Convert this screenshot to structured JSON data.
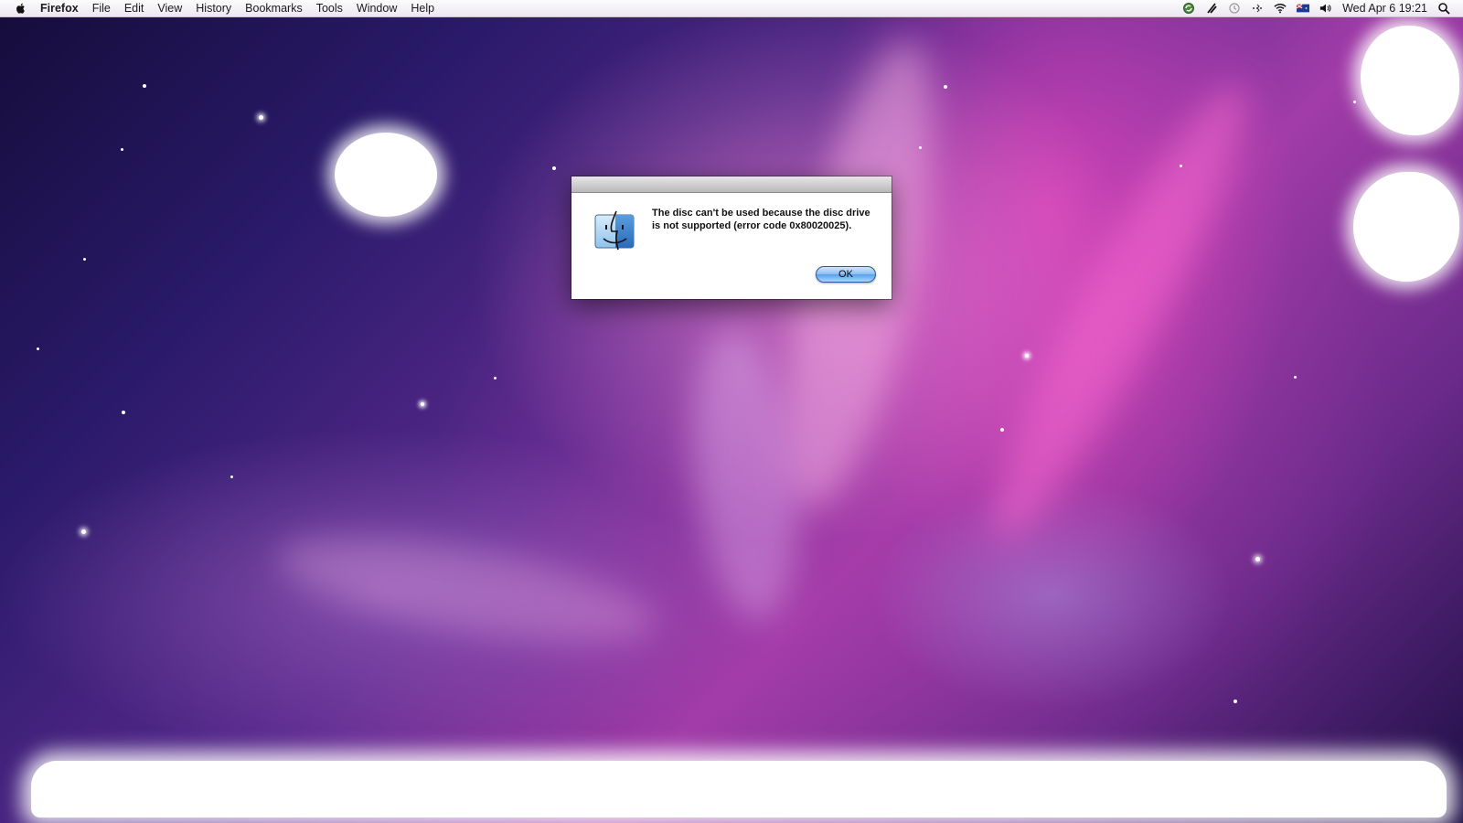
{
  "menubar": {
    "app_name": "Firefox",
    "items": [
      "File",
      "Edit",
      "View",
      "History",
      "Bookmarks",
      "Tools",
      "Window",
      "Help"
    ],
    "status_icons": [
      "sync-icon",
      "script-icon",
      "time-machine-icon",
      "bluetooth-icon",
      "wifi-icon",
      "flag-icon",
      "volume-icon"
    ],
    "clock": "Wed Apr 6  19:21"
  },
  "alert": {
    "message": "The disc can't be used because the disc drive is not supported (error code 0x80020025).",
    "ok_label": "OK",
    "icon": "finder-icon"
  },
  "colors": {
    "wallpaper_dark": "#1c0f45",
    "wallpaper_pink": "#e046be",
    "button_blue": "#5aa0ea"
  }
}
